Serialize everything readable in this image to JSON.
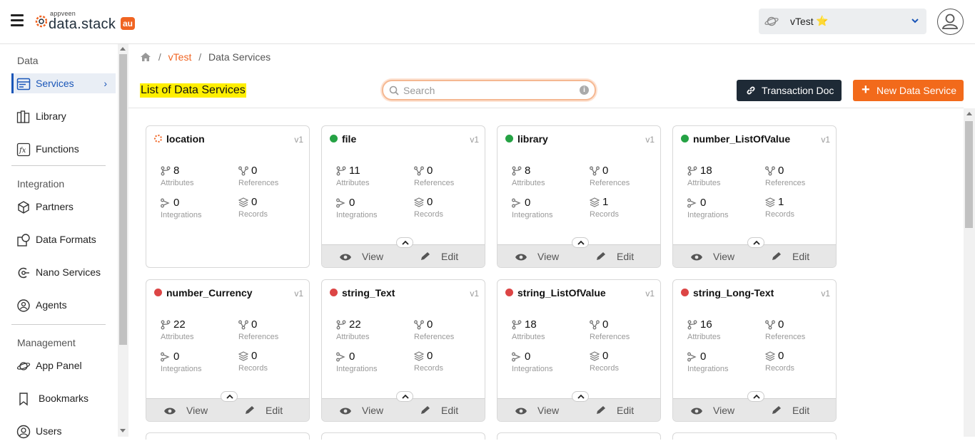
{
  "header": {
    "logo_small": "appveen",
    "logo_text": "data.stack",
    "logo_badge": "au",
    "app_name": "vTest",
    "app_star": "⭐"
  },
  "sidebar": {
    "sections": [
      {
        "title": "Data",
        "items": [
          {
            "label": "Services",
            "icon": "services-icon",
            "active": true
          },
          {
            "label": "Library",
            "icon": "library-icon"
          },
          {
            "label": "Functions",
            "icon": "functions-icon"
          }
        ]
      },
      {
        "title": "Integration",
        "items": [
          {
            "label": "Partners",
            "icon": "partners-icon"
          },
          {
            "label": "Data Formats",
            "icon": "data-formats-icon"
          },
          {
            "label": "Nano Services",
            "icon": "nano-services-icon"
          },
          {
            "label": "Agents",
            "icon": "agents-icon"
          }
        ]
      },
      {
        "title": "Management",
        "items": [
          {
            "label": "App Panel",
            "icon": "app-panel-icon"
          },
          {
            "label": "Bookmarks",
            "icon": "bookmark-icon"
          },
          {
            "label": "Users",
            "icon": "users-icon"
          }
        ]
      }
    ]
  },
  "breadcrumb": {
    "app": "vTest",
    "sep": "/",
    "current": "Data Services"
  },
  "page": {
    "title": "List of Data Services",
    "search_placeholder": "Search",
    "transaction_btn": "Transaction Doc",
    "new_btn": "New Data Service"
  },
  "labels": {
    "attributes": "Attributes",
    "references": "References",
    "integrations": "Integrations",
    "records": "Records",
    "view": "View",
    "edit": "Edit"
  },
  "cards": [
    {
      "name": "location",
      "version": "v1",
      "status": "loading",
      "attributes": "8",
      "references": "0",
      "integrations": "0",
      "records": "0",
      "has_footer": false
    },
    {
      "name": "file",
      "version": "v1",
      "status": "green",
      "attributes": "11",
      "references": "0",
      "integrations": "0",
      "records": "0",
      "has_footer": true
    },
    {
      "name": "library",
      "version": "v1",
      "status": "green",
      "attributes": "8",
      "references": "0",
      "integrations": "0",
      "records": "1",
      "has_footer": true
    },
    {
      "name": "number_ListOfValue",
      "version": "v1",
      "status": "green",
      "attributes": "18",
      "references": "0",
      "integrations": "0",
      "records": "1",
      "has_footer": true
    },
    {
      "name": "number_Currency",
      "version": "v1",
      "status": "red",
      "attributes": "22",
      "references": "0",
      "integrations": "0",
      "records": "0",
      "has_footer": true
    },
    {
      "name": "string_Text",
      "version": "v1",
      "status": "red",
      "attributes": "22",
      "references": "0",
      "integrations": "0",
      "records": "0",
      "has_footer": true
    },
    {
      "name": "string_ListOfValue",
      "version": "v1",
      "status": "red",
      "attributes": "18",
      "references": "0",
      "integrations": "0",
      "records": "0",
      "has_footer": true
    },
    {
      "name": "string_Long-Text",
      "version": "v1",
      "status": "red",
      "attributes": "16",
      "references": "0",
      "integrations": "0",
      "records": "0",
      "has_footer": true
    }
  ],
  "colors": {
    "accent": "#f06422",
    "active_nav": "#1a56b8",
    "status_green": "#25a244",
    "status_red": "#dc4545",
    "dark_button": "#1e2a36",
    "highlight": "#ffef00"
  }
}
